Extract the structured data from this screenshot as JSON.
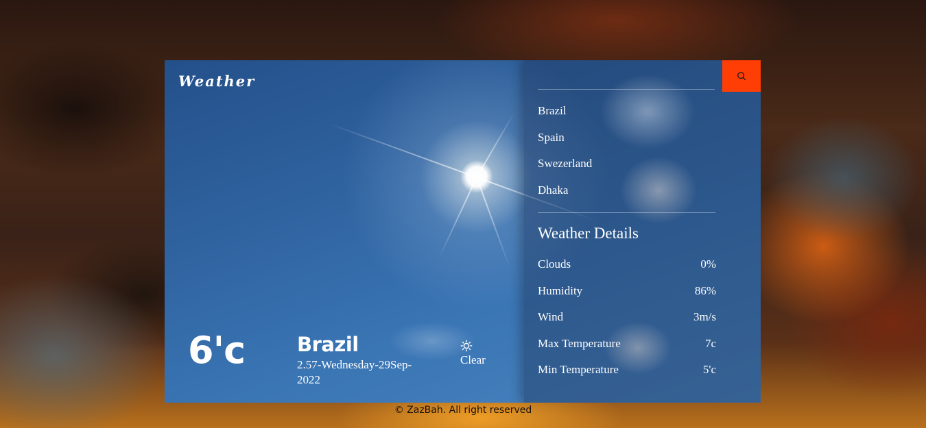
{
  "app": {
    "logo": "Weather"
  },
  "current": {
    "temperature": "6'c",
    "city": "Brazil",
    "datetime": "2.57-Wednesday-29Sep-2022",
    "condition": "Clear",
    "condition_icon": "sun-icon"
  },
  "search": {
    "value": "",
    "placeholder": "",
    "button_icon": "search-icon",
    "button_color": "#ff3e05"
  },
  "cities": [
    {
      "label": "Brazil"
    },
    {
      "label": "Spain"
    },
    {
      "label": "Swezerland"
    },
    {
      "label": "Dhaka"
    }
  ],
  "details": {
    "title": "Weather Details",
    "rows": [
      {
        "label": "Clouds",
        "value": "0%"
      },
      {
        "label": "Humidity",
        "value": "86%"
      },
      {
        "label": "Wind",
        "value": "3m/s"
      },
      {
        "label": "Max Temperature",
        "value": "7c"
      },
      {
        "label": "Min Temperature",
        "value": "5'c"
      }
    ]
  },
  "footer": {
    "text": "© ZazBah. All right reserved"
  }
}
